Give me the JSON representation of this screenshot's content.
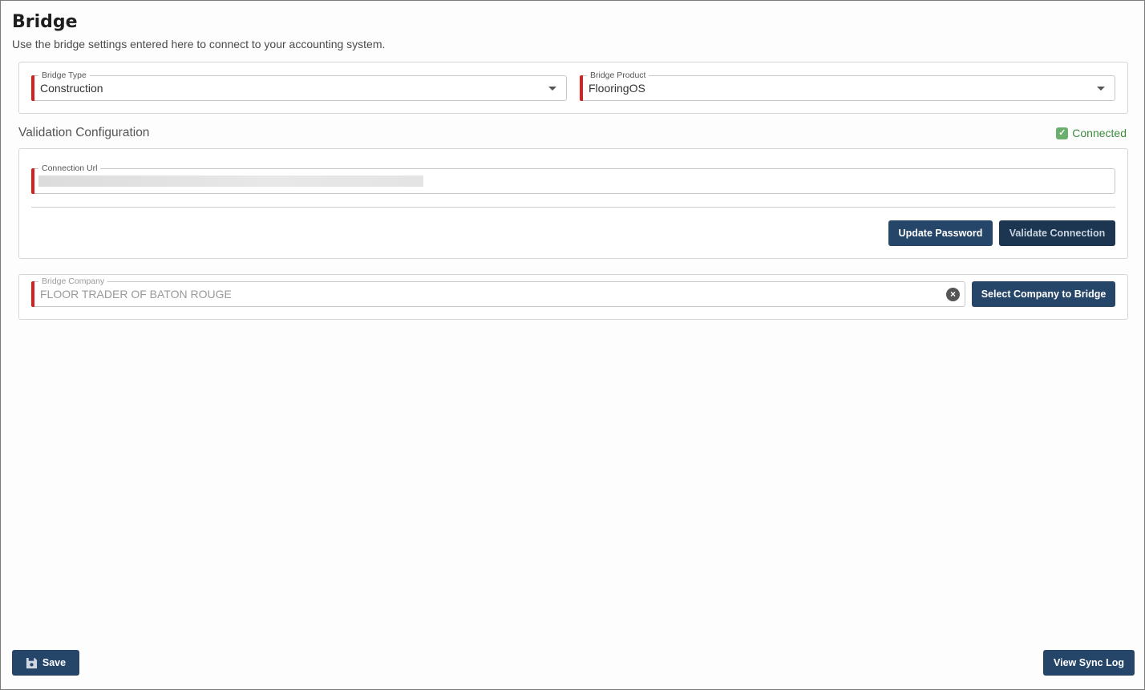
{
  "header": {
    "title": "Bridge",
    "subtitle": "Use the bridge settings entered here to connect to your accounting system."
  },
  "bridge_type": {
    "label": "Bridge Type",
    "value": "Construction"
  },
  "bridge_product": {
    "label": "Bridge Product",
    "value": "FlooringOS"
  },
  "validation": {
    "title": "Validation Configuration",
    "status_label": "Connected",
    "status_color": "#3d8a3d",
    "connection_url_label": "Connection Url",
    "connection_url_value": "",
    "update_password_label": "Update Password",
    "validate_connection_label": "Validate Connection"
  },
  "company": {
    "label": "Bridge Company",
    "value": "FLOOR TRADER OF BATON ROUGE",
    "select_button_label": "Select Company to Bridge"
  },
  "footer": {
    "save_label": "Save",
    "view_sync_log_label": "View Sync Log"
  },
  "colors": {
    "primary_button": "#254668",
    "required_marker": "#d62020",
    "connected_check": "#6cae6c"
  },
  "icons": {
    "connected": "check-square-icon",
    "clear": "clear-circle-icon",
    "save": "floppy-disk-icon",
    "dropdown": "caret-down-icon"
  }
}
